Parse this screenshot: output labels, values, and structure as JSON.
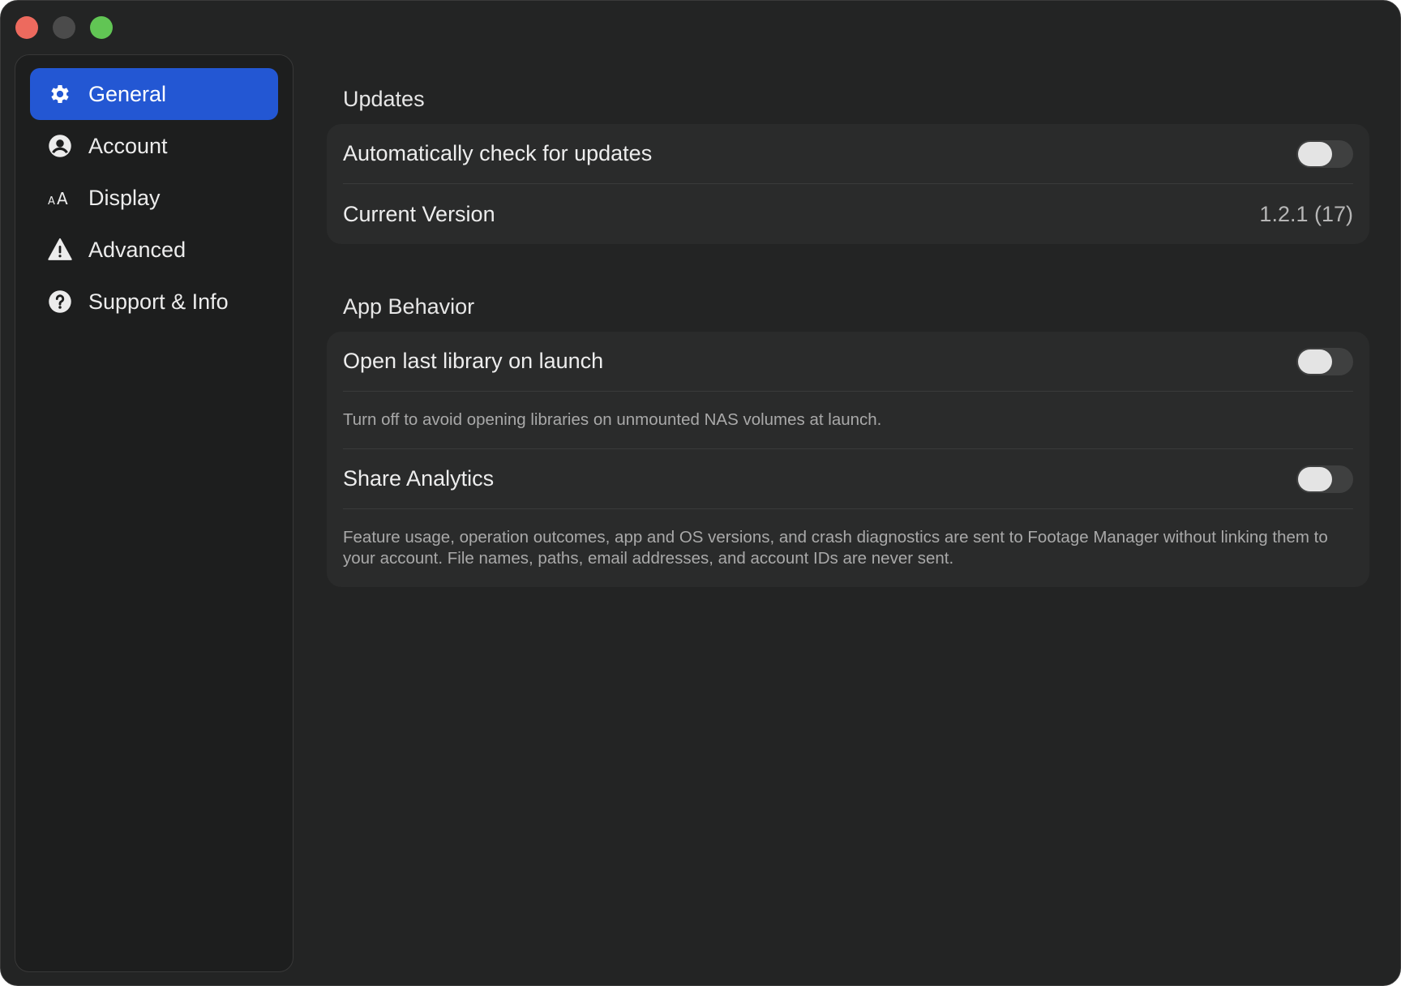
{
  "window": {
    "controls": {
      "close_color": "#ed6a5e",
      "minimize_color": "#4b4b4b",
      "maximize_color": "#61c554"
    }
  },
  "sidebar": {
    "items": [
      {
        "label": "General",
        "icon": "gear-icon",
        "active": true
      },
      {
        "label": "Account",
        "icon": "person-circle-icon",
        "active": false
      },
      {
        "label": "Display",
        "icon": "text-size-icon",
        "active": false
      },
      {
        "label": "Advanced",
        "icon": "warning-triangle-icon",
        "active": false
      },
      {
        "label": "Support & Info",
        "icon": "question-circle-icon",
        "active": false
      }
    ],
    "active_color": "#2357d3"
  },
  "sections": {
    "updates": {
      "title": "Updates",
      "auto_check": {
        "label": "Automatically check for updates",
        "enabled": false
      },
      "current_version": {
        "label": "Current Version",
        "value": "1.2.1 (17)"
      }
    },
    "app_behavior": {
      "title": "App Behavior",
      "open_last_library": {
        "label": "Open last library on launch",
        "enabled": false,
        "help": "Turn off to avoid opening libraries on unmounted NAS volumes at launch."
      },
      "share_analytics": {
        "label": "Share Analytics",
        "enabled": false,
        "help": "Feature usage, operation outcomes, app and OS versions, and crash diagnostics are sent to Footage Manager without linking them to your account. File names, paths, email addresses, and account IDs are never sent."
      }
    }
  }
}
